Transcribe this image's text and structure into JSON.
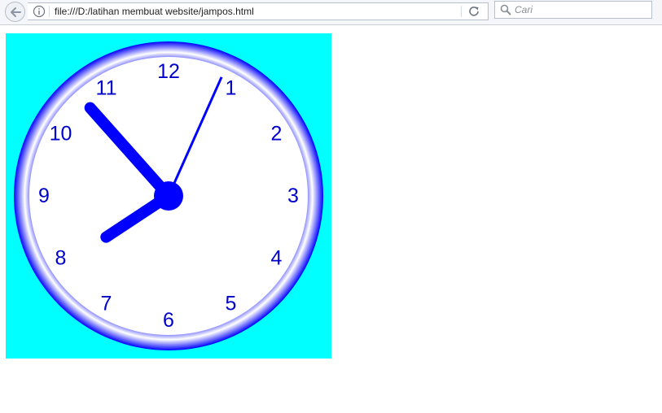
{
  "browser": {
    "url": "file:///D:/latihan membuat website/jampos.html",
    "search_placeholder": "Cari",
    "icons": {
      "back": "back-arrow-icon",
      "info": "info-icon",
      "reload": "reload-icon",
      "search": "search-icon"
    }
  },
  "clock": {
    "background_color": "#00ffff",
    "accent_color": "#0000ff",
    "numerals": [
      "12",
      "1",
      "2",
      "3",
      "4",
      "5",
      "6",
      "7",
      "8",
      "9",
      "10",
      "11"
    ],
    "time": {
      "hour": 7,
      "minute": 53,
      "second": 4
    }
  }
}
